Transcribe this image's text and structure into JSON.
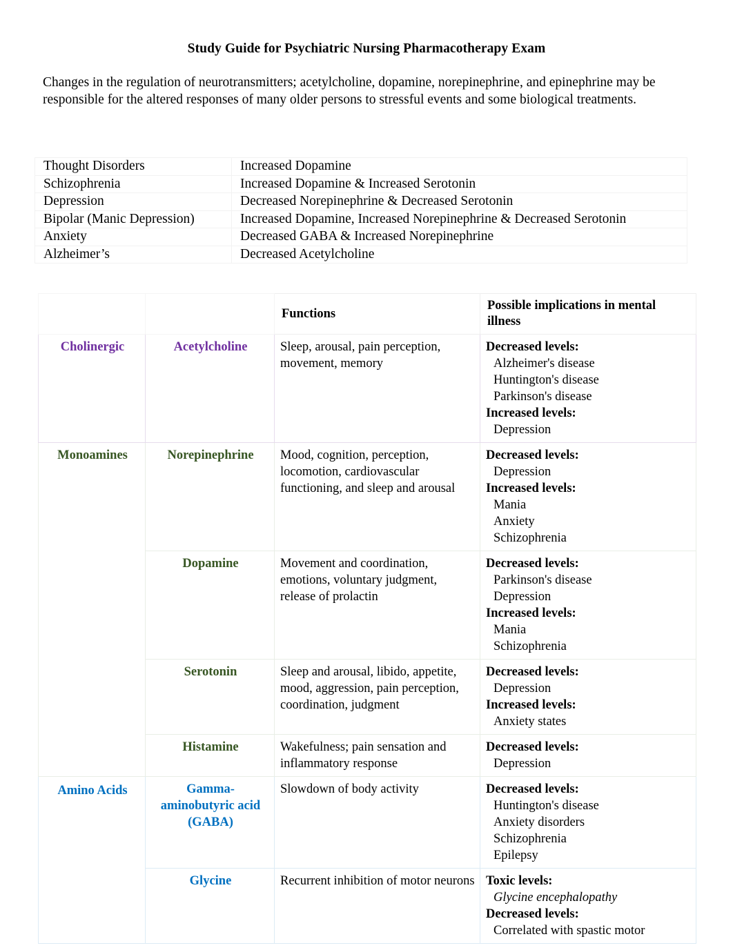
{
  "document": {
    "title": "Study Guide for Psychiatric Nursing Pharmacotherapy Exam",
    "intro": "Changes in the regulation of neurotransmitters; acetylcholine, dopamine, norepinephrine, and epinephrine may be responsible for the altered responses of many older persons to stressful events and some biological treatments."
  },
  "colors": {
    "cholinergic": "#7030A0",
    "monoamines": "#375623",
    "amino_acids": "#0070C0",
    "text": "#000000"
  },
  "disorder_table": {
    "rows": [
      {
        "disorder": "Thought Disorders",
        "neurotransmitters": "Increased Dopamine"
      },
      {
        "disorder": "Schizophrenia",
        "neurotransmitters": "Increased Dopamine & Increased Serotonin"
      },
      {
        "disorder": "Depression",
        "neurotransmitters": "Decreased Norepinephrine & Decreased Serotonin"
      },
      {
        "disorder": "Bipolar (Manic Depression)",
        "neurotransmitters": "Increased Dopamine, Increased Norepinephrine & Decreased Serotonin"
      },
      {
        "disorder": "Anxiety",
        "neurotransmitters": "Decreased GABA & Increased Norepinephrine"
      },
      {
        "disorder": "Alzheimer’s",
        "neurotransmitters": "Decreased Acetylcholine"
      }
    ]
  },
  "neurotransmitter_table": {
    "headers": {
      "col1": "",
      "col2": "",
      "functions": "Functions",
      "implications": "Possible implications in mental illness"
    },
    "groups": {
      "cholinergic": "Cholinergic",
      "monoamines": "Monoamines",
      "amino_acids": "Amino Acids"
    },
    "rows": [
      {
        "name": "Acetylcholine",
        "functions": "Sleep, arousal, pain perception, movement, memory",
        "implications": [
          {
            "type": "label",
            "text": "Decreased levels:"
          },
          {
            "type": "item",
            "text": "Alzheimer's disease"
          },
          {
            "type": "item",
            "text": "Huntington's disease"
          },
          {
            "type": "item",
            "text": "Parkinson's disease"
          },
          {
            "type": "label",
            "text": "Increased levels:"
          },
          {
            "type": "item",
            "text": "Depression"
          }
        ]
      },
      {
        "name": "Norepinephrine",
        "functions": "Mood, cognition, perception, locomotion, cardiovascular functioning, and sleep and arousal",
        "implications": [
          {
            "type": "label",
            "text": "Decreased levels:"
          },
          {
            "type": "item",
            "text": "Depression"
          },
          {
            "type": "label",
            "text": "Increased levels:"
          },
          {
            "type": "item",
            "text": "Mania"
          },
          {
            "type": "item",
            "text": "Anxiety"
          },
          {
            "type": "item",
            "text": "Schizophrenia"
          }
        ]
      },
      {
        "name": "Dopamine",
        "functions": "Movement and coordination, emotions, voluntary judgment, release of prolactin",
        "implications": [
          {
            "type": "label",
            "text": "Decreased levels:"
          },
          {
            "type": "item",
            "text": "Parkinson's disease"
          },
          {
            "type": "item",
            "text": "Depression"
          },
          {
            "type": "label",
            "text": "Increased levels:"
          },
          {
            "type": "item",
            "text": "Mania"
          },
          {
            "type": "item",
            "text": "Schizophrenia"
          }
        ]
      },
      {
        "name": "Serotonin",
        "functions": "Sleep and arousal, libido, appetite, mood, aggression, pain perception, coordination, judgment",
        "implications": [
          {
            "type": "label",
            "text": "Decreased levels:"
          },
          {
            "type": "item",
            "text": "Depression"
          },
          {
            "type": "label",
            "text": "Increased levels:"
          },
          {
            "type": "item",
            "text": "Anxiety states"
          }
        ]
      },
      {
        "name": "Histamine",
        "functions": "Wakefulness; pain sensation and inflammatory response",
        "implications": [
          {
            "type": "label",
            "text": "Decreased levels:"
          },
          {
            "type": "item",
            "text": "Depression"
          }
        ]
      },
      {
        "name": "Gamma-aminobutyric acid (GABA)",
        "functions": "Slowdown of body activity",
        "implications": [
          {
            "type": "label",
            "text": "Decreased levels:"
          },
          {
            "type": "item",
            "text": "Huntington's disease"
          },
          {
            "type": "item",
            "text": "Anxiety disorders"
          },
          {
            "type": "item",
            "text": "Schizophrenia"
          },
          {
            "type": "item",
            "text": "Epilepsy"
          }
        ]
      },
      {
        "name": "Glycine",
        "functions": "Recurrent inhibition of motor neurons",
        "implications": [
          {
            "type": "label",
            "text": "Toxic levels:"
          },
          {
            "type": "item-italic",
            "text": "Glycine encephalopathy"
          },
          {
            "type": "label",
            "text": "Decreased levels:"
          },
          {
            "type": "item",
            "text": "Correlated with spastic motor"
          }
        ]
      }
    ]
  }
}
